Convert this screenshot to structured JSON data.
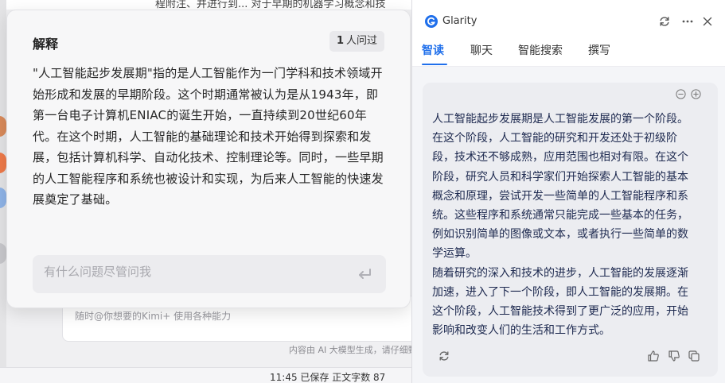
{
  "background": {
    "top_text": "程附注、并进行到... 对于早期的机器学习概念和技",
    "input_hint": "随时@你想要的Kimi+ 使用各种能力",
    "disclaimer": "内容由 AI 大模型生成，请仔细甄别",
    "status": "11:45  已保存    正文字数  87"
  },
  "explain_popup": {
    "title": "解释",
    "asked_count": "1",
    "asked_suffix": "人问过",
    "body": "\"人工智能起步发展期\"指的是人工智能作为一门学科和技术领域开始形成和发展的早期阶段。这个时期通常被认为是从1943年，即第一台电子计算机ENIAC的诞生开始，一直持续到20世纪60年代。在这个时期，人工智能的基础理论和技术开始得到探索和发展，包括计算机科学、自动化技术、控制理论等。同时，一些早期的人工智能程序和系统也被设计和实现，为后来人工智能的快速发展奠定了基础。",
    "ask_placeholder": "有什么问题尽管问我",
    "ask_value": ""
  },
  "glarity": {
    "app_name": "Glarity",
    "tabs": [
      {
        "label": "智读",
        "active": true
      },
      {
        "label": "聊天",
        "active": false
      },
      {
        "label": "智能搜索",
        "active": false
      },
      {
        "label": "撰写",
        "active": false
      }
    ],
    "summary_paragraphs": [
      "人工智能起步发展期是人工智能发展的第一个阶段。在这个阶段，人工智能的研究和开发还处于初级阶段，技术还不够成熟，应用范围也相对有限。在这个阶段，研究人员和科学家们开始探索人工智能的基本概念和原理，尝试开发一些简单的人工智能程序和系统。这些程序和系统通常只能完成一些基本的任务，例如识别简单的图像或文本，或者执行一些简单的数学运算。",
      "随着研究的深入和技术的进步，人工智能的发展逐渐加速，进入了下一个阶段，即人工智能的发展期。在这个阶段，人工智能技术得到了更广泛的应用，开始影响和改变人们的生活和工作方式。"
    ],
    "accent_color": "#1f6feb"
  }
}
